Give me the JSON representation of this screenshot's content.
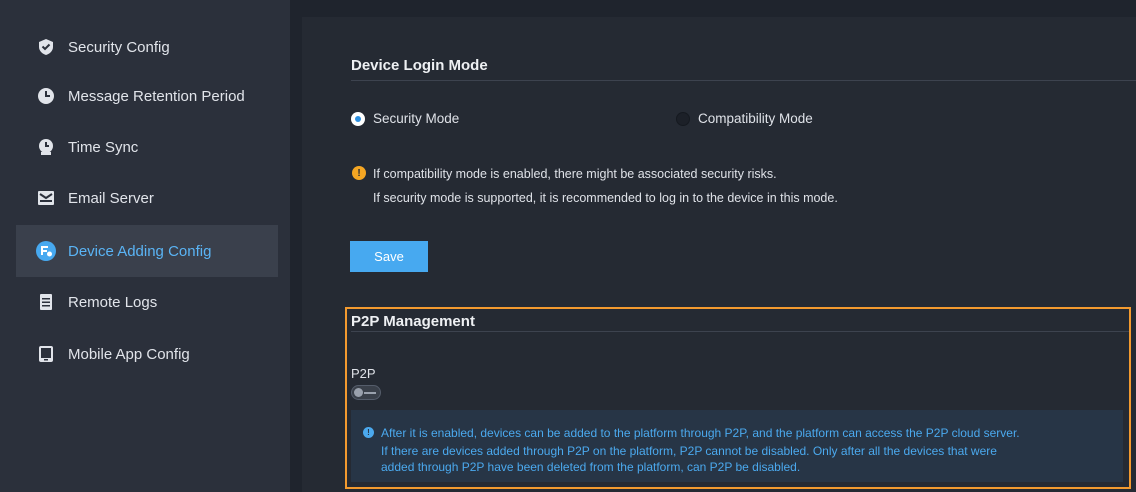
{
  "sidebar": {
    "items": [
      {
        "label": "Security Config",
        "icon": "shield-icon"
      },
      {
        "label": "Message Retention Period",
        "icon": "clock-icon"
      },
      {
        "label": "Time Sync",
        "icon": "time-sync-icon"
      },
      {
        "label": "Email Server",
        "icon": "email-icon"
      },
      {
        "label": "Device Adding Config",
        "icon": "device-config-icon",
        "active": true
      },
      {
        "label": "Remote Logs",
        "icon": "document-icon"
      },
      {
        "label": "Mobile App Config",
        "icon": "mobile-icon"
      }
    ]
  },
  "login_mode": {
    "title": "Device Login Mode",
    "security_label": "Security Mode",
    "compatibility_label": "Compatibility Mode",
    "selected": "Security Mode",
    "warning_line1": "If compatibility mode is enabled, there might be associated security risks.",
    "warning_line2": "If security mode is supported, it is recommended to log in to the device in this mode.",
    "save_label": "Save"
  },
  "p2p": {
    "title": "P2P Management",
    "label": "P2P",
    "enabled": false,
    "info_line1": "After it is enabled, devices can be added to the platform through P2P,  and the platform can access the P2P cloud server.",
    "info_line2": "If there are devices added through P2P on the platform, P2P cannot be disabled. Only after all the devices that were",
    "info_line3": "added through P2P have been deleted from the platform, can P2P be disabled."
  },
  "colors": {
    "accent": "#47a9f0",
    "highlight_border": "#f39a2f",
    "warning": "#f5a623",
    "sidebar_bg": "#2b303b",
    "main_bg": "#252a33"
  }
}
